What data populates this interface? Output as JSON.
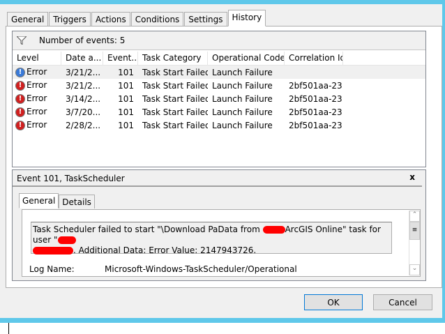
{
  "tabs": [
    "General",
    "Triggers",
    "Actions",
    "Conditions",
    "Settings",
    "History"
  ],
  "toolbar": {
    "filter_icon": "filter-icon",
    "count_label": "Number of events: 5"
  },
  "columns": [
    "Level",
    "Date a...",
    "Event...",
    "Task Category",
    "Operational Code",
    "Correlation Id"
  ],
  "rows": [
    {
      "level": "Error",
      "date": "3/21/2...",
      "event": "101",
      "category": "Task Start Failed",
      "opcode": "Launch Failure",
      "corr": ""
    },
    {
      "level": "Error",
      "date": "3/21/2...",
      "event": "101",
      "category": "Task Start Failed",
      "opcode": "Launch Failure",
      "corr": "2bf501aa-23..."
    },
    {
      "level": "Error",
      "date": "3/14/2...",
      "event": "101",
      "category": "Task Start Failed",
      "opcode": "Launch Failure",
      "corr": "2bf501aa-23..."
    },
    {
      "level": "Error",
      "date": "3/7/20...",
      "event": "101",
      "category": "Task Start Failed",
      "opcode": "Launch Failure",
      "corr": "2bf501aa-23..."
    },
    {
      "level": "Error",
      "date": "2/28/2...",
      "event": "101",
      "category": "Task Start Failed",
      "opcode": "Launch Failure",
      "corr": "2bf501aa-23..."
    }
  ],
  "detail": {
    "title": "Event 101, TaskScheduler",
    "close": "x",
    "tabs": [
      "General",
      "Details"
    ],
    "msg_part1": "Task Scheduler failed to start \"\\Download PaData from ",
    "msg_part2": "ArcGIS Online\" task for user \"",
    "msg_part3": ". Additional Data: Error Value: 2147943726.",
    "log_label": "Log Name:",
    "log_value": "Microsoft-Windows-TaskScheduler/Operational"
  },
  "buttons": {
    "ok": "OK",
    "cancel": "Cancel"
  }
}
